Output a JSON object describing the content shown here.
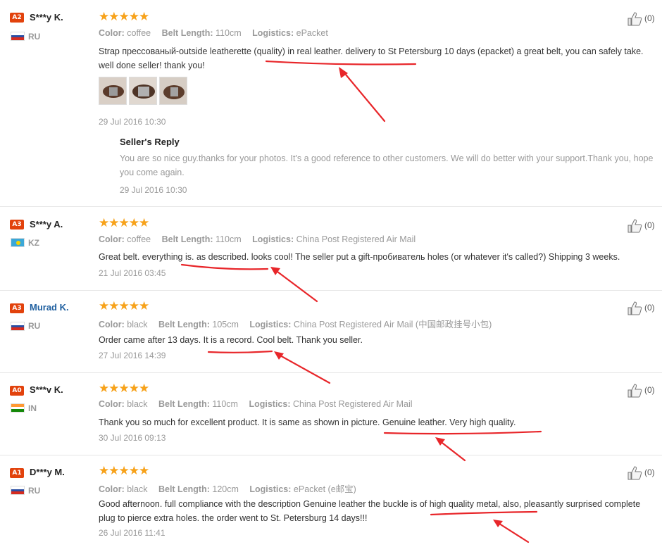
{
  "reviews": [
    {
      "level": "A2",
      "name": "S***y K.",
      "country": "RU",
      "flag": [
        "#ffffff",
        "#2c4fa3",
        "#d52b1e"
      ],
      "stars": "★★★★★",
      "attrs": [
        {
          "label": "Color:",
          "value": "coffee"
        },
        {
          "label": "Belt Length:",
          "value": "110cm"
        },
        {
          "label": "Logistics:",
          "value": "ePacket"
        }
      ],
      "text": "Strap прессованый-outside leatherette (quality) in real leather. delivery to St Petersburg 10 days (epacket) a great belt, you can safely take. well done seller! thank you!",
      "date": "29 Jul 2016 10:30",
      "likes": "(0)",
      "reply": {
        "title": "Seller's Reply",
        "text": "You are so nice guy.thanks for your photos. It's a good reference to other customers. We will do better with your support.Thank you, hope you come again.",
        "date": "29 Jul 2016 10:30"
      }
    },
    {
      "level": "A3",
      "name": "S***y A.",
      "country": "KZ",
      "flag": [
        "#3aa8d8",
        "#3aa8d8",
        "#3aa8d8"
      ],
      "stars": "★★★★★",
      "attrs": [
        {
          "label": "Color:",
          "value": "coffee"
        },
        {
          "label": "Belt Length:",
          "value": "110cm"
        },
        {
          "label": "Logistics:",
          "value": "China Post Registered Air Mail"
        }
      ],
      "text": "Great belt. everything is. as described. looks cool! The seller put a gift-пробиватель holes (or whatever it's called?) Shipping 3 weeks.",
      "date": "21 Jul 2016 03:45",
      "likes": "(0)"
    },
    {
      "level": "A3",
      "name": "Murad K.",
      "country": "RU",
      "flag": [
        "#ffffff",
        "#2c4fa3",
        "#d52b1e"
      ],
      "stars": "★★★★★",
      "attrs": [
        {
          "label": "Color:",
          "value": "black"
        },
        {
          "label": "Belt Length:",
          "value": "105cm"
        },
        {
          "label": "Logistics:",
          "value": "China Post Registered Air Mail (中国邮政挂号小包)"
        }
      ],
      "text": "Order came after 13 days. It is a record. Cool belt. Thank you seller.",
      "date": "27 Jul 2016 14:39",
      "likes": "(0)"
    },
    {
      "level": "A0",
      "name": "S***v K.",
      "country": "IN",
      "flag": [
        "#ff9933",
        "#ffffff",
        "#138808"
      ],
      "stars": "★★★★★",
      "attrs": [
        {
          "label": "Color:",
          "value": "black"
        },
        {
          "label": "Belt Length:",
          "value": "110cm"
        },
        {
          "label": "Logistics:",
          "value": "China Post Registered Air Mail"
        }
      ],
      "text": "Thank you so much for excellent product. It is same as shown in picture. Genuine leather. Very high quality.",
      "date": "30 Jul 2016 09:13",
      "likes": "(0)"
    },
    {
      "level": "A1",
      "name": "D***y M.",
      "country": "RU",
      "flag": [
        "#ffffff",
        "#2c4fa3",
        "#d52b1e"
      ],
      "stars": "★★★★★",
      "attrs": [
        {
          "label": "Color:",
          "value": "black"
        },
        {
          "label": "Belt Length:",
          "value": "120cm"
        },
        {
          "label": "Logistics:",
          "value": "ePacket (e邮宝)"
        }
      ],
      "text": "Good afternoon. full compliance with the description Genuine leather the buckle is of high quality metal, also, pleasantly surprised complete plug to pierce extra holes. the order went to St. Petersburg 14 days!!!",
      "date": "26 Jul 2016 11:41",
      "likes": "(0)"
    }
  ],
  "colors": {
    "badge": "#e2420c",
    "stars": "#f7a21a",
    "annotation": "#e8262a",
    "name_link": "#2060a0"
  },
  "icons": {
    "like": "thumbs-up-icon"
  }
}
